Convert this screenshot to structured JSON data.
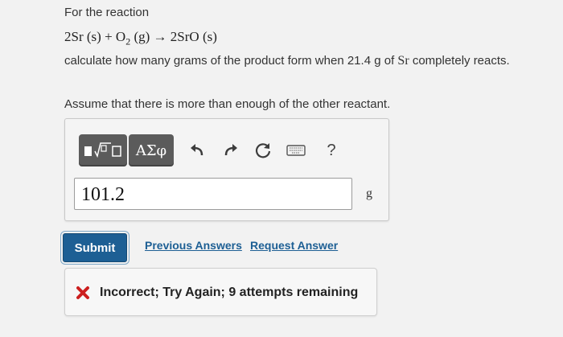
{
  "problem": {
    "intro": "For the reaction",
    "equation": {
      "coef1": "2",
      "sr": "Sr",
      "state_s": "(s)",
      "plus": "+",
      "o": "O",
      "o_sub": "2",
      "state_g": "(g)",
      "arrow": "→",
      "product": "2SrO",
      "state_s2": "(s)"
    },
    "question": {
      "before": "calculate how many grams of the product form when ",
      "amount": "21.4 g",
      "of": " of ",
      "element": "Sr",
      "after": " completely reacts."
    },
    "assume": "Assume that there is more than enough of the other reactant."
  },
  "toolbar": {
    "greek_label": "ΑΣφ",
    "help_label": "?",
    "icons": [
      "templates-icon",
      "undo-icon",
      "redo-icon",
      "reset-icon",
      "keyboard-icon",
      "help-icon"
    ]
  },
  "answer": {
    "value": "101.2",
    "unit": "g"
  },
  "actions": {
    "submit_label": "Submit",
    "previous_answers_label": "Previous Answers",
    "request_answer_label": "Request Answer"
  },
  "feedback": {
    "status_color": "#cc1f1f",
    "message": "Incorrect; Try Again; 9 attempts remaining"
  }
}
